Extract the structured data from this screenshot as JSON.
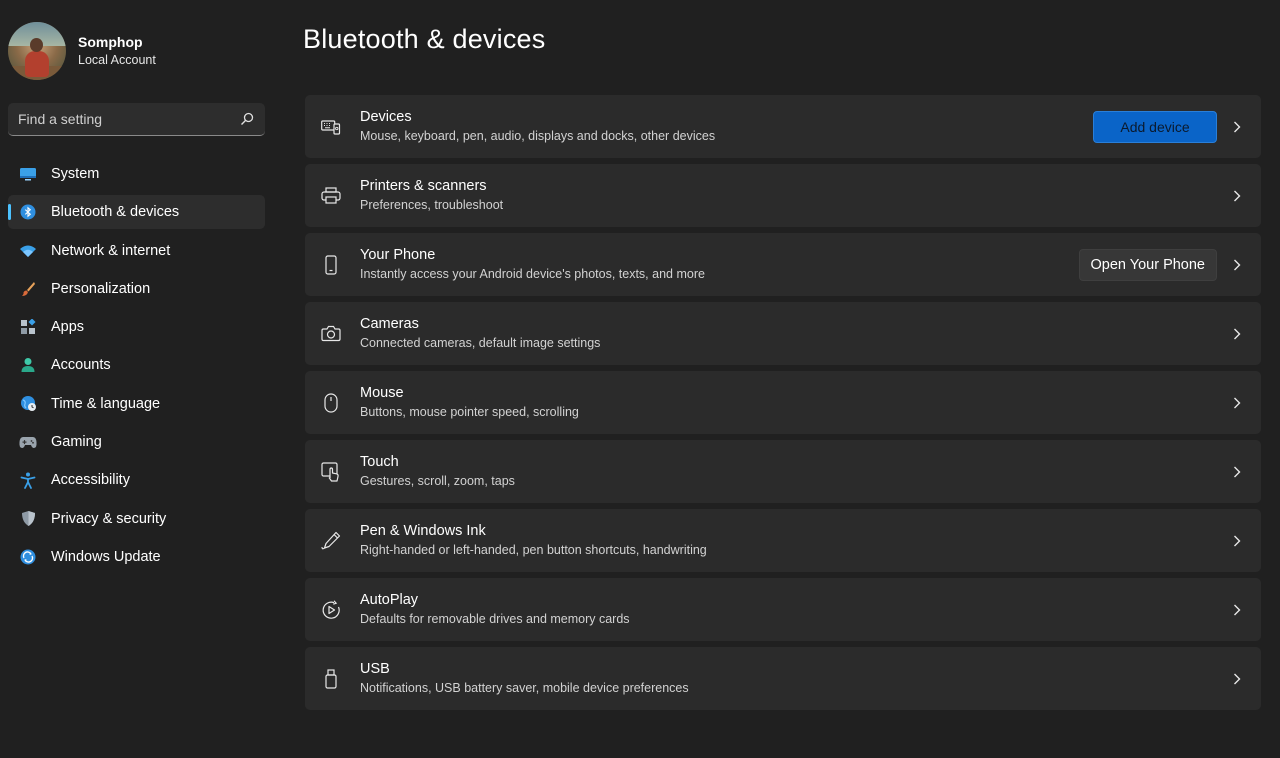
{
  "profile": {
    "name": "Somphop",
    "account_type": "Local Account"
  },
  "search": {
    "placeholder": "Find a setting",
    "icon": "search-icon"
  },
  "sidebar": {
    "items": [
      {
        "label": "System",
        "icon": "system-icon"
      },
      {
        "label": "Bluetooth & devices",
        "icon": "bluetooth-icon",
        "active": true
      },
      {
        "label": "Network & internet",
        "icon": "wifi-icon"
      },
      {
        "label": "Personalization",
        "icon": "brush-icon"
      },
      {
        "label": "Apps",
        "icon": "apps-icon"
      },
      {
        "label": "Accounts",
        "icon": "person-icon"
      },
      {
        "label": "Time & language",
        "icon": "globe-clock-icon"
      },
      {
        "label": "Gaming",
        "icon": "gamepad-icon"
      },
      {
        "label": "Accessibility",
        "icon": "accessibility-icon"
      },
      {
        "label": "Privacy & security",
        "icon": "shield-icon"
      },
      {
        "label": "Windows Update",
        "icon": "update-icon"
      }
    ]
  },
  "main": {
    "title": "Bluetooth & devices",
    "cards": [
      {
        "title": "Devices",
        "subtitle": "Mouse, keyboard, pen, audio, displays and docks, other devices",
        "icon": "devices-icon",
        "button": "Add device"
      },
      {
        "title": "Printers & scanners",
        "subtitle": "Preferences, troubleshoot",
        "icon": "printer-icon"
      },
      {
        "title": "Your Phone",
        "subtitle": "Instantly access your Android device's photos, texts, and more",
        "icon": "phone-icon",
        "button": "Open Your Phone"
      },
      {
        "title": "Cameras",
        "subtitle": "Connected cameras, default image settings",
        "icon": "camera-icon"
      },
      {
        "title": "Mouse",
        "subtitle": "Buttons, mouse pointer speed, scrolling",
        "icon": "mouse-icon"
      },
      {
        "title": "Touch",
        "subtitle": "Gestures, scroll, zoom, taps",
        "icon": "touch-icon"
      },
      {
        "title": "Pen & Windows Ink",
        "subtitle": "Right-handed or left-handed, pen button shortcuts, handwriting",
        "icon": "pen-icon"
      },
      {
        "title": "AutoPlay",
        "subtitle": "Defaults for removable drives and memory cards",
        "icon": "autoplay-icon"
      },
      {
        "title": "USB",
        "subtitle": "Notifications, USB battery saver, mobile device preferences",
        "icon": "usb-icon"
      }
    ]
  },
  "colors": {
    "background": "#202020",
    "card": "#2b2b2b",
    "accent": "#4cc2ff",
    "primary_button": "#0a64c8"
  }
}
